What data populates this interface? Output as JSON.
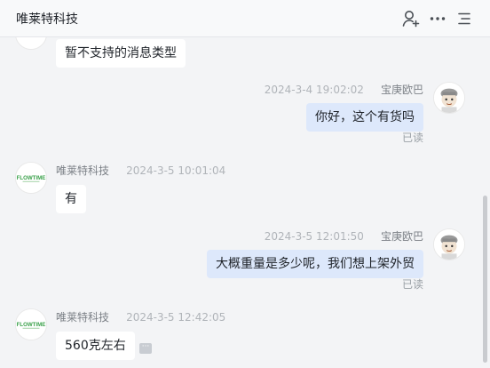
{
  "header": {
    "title": "唯莱特科技",
    "icons": [
      "add-user-icon",
      "more-icon",
      "menu-icon"
    ]
  },
  "messages": [
    {
      "direction": "in",
      "text": "暂不支持的消息类型",
      "partial": true
    },
    {
      "direction": "out",
      "sender": "宝庚欧巴",
      "time": "2024-3-4 19:02:02",
      "text": "你好，这个有货吗",
      "status": "已读"
    },
    {
      "direction": "in",
      "sender": "唯莱特科技",
      "time": "2024-3-5 10:01:04",
      "text": "有"
    },
    {
      "direction": "out",
      "sender": "宝庚欧巴",
      "time": "2024-3-5 12:01:50",
      "text": "大概重量是多少呢，我们想上架外贸",
      "status": "已读"
    },
    {
      "direction": "in",
      "sender": "唯莱特科技",
      "time": "2024-3-5 12:42:05",
      "text": "560克左右"
    }
  ],
  "logo_text": "FLOWTIME"
}
